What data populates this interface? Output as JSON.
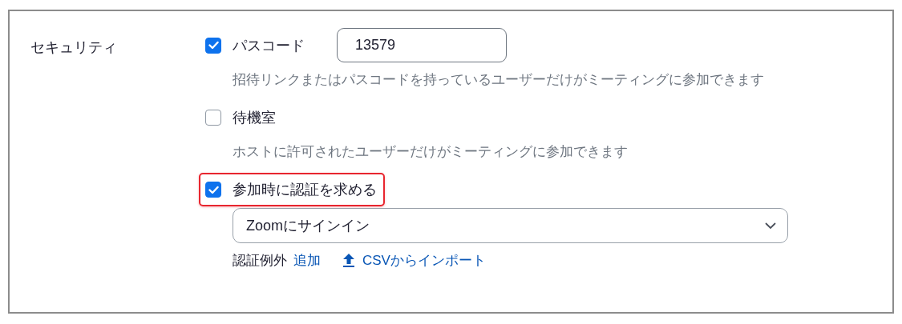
{
  "section": {
    "label": "セキュリティ"
  },
  "options": [
    {
      "kind": "passcode",
      "label": "パスコード",
      "checked": true,
      "highlighted": false,
      "value": "13579",
      "description": "招待リンクまたはパスコードを持っているユーザーだけがミーティングに参加できます"
    },
    {
      "kind": "plain",
      "label": "待機室",
      "checked": false,
      "highlighted": false,
      "description": "ホストに許可されたユーザーだけがミーティングに参加できます"
    },
    {
      "kind": "auth",
      "label": "参加時に認証を求める",
      "checked": true,
      "highlighted": true,
      "select": {
        "value": "Zoomにサインイン"
      },
      "exceptions": {
        "label": "認証例外",
        "add_link": "追加",
        "import_link": "CSVからインポート"
      }
    }
  ]
}
